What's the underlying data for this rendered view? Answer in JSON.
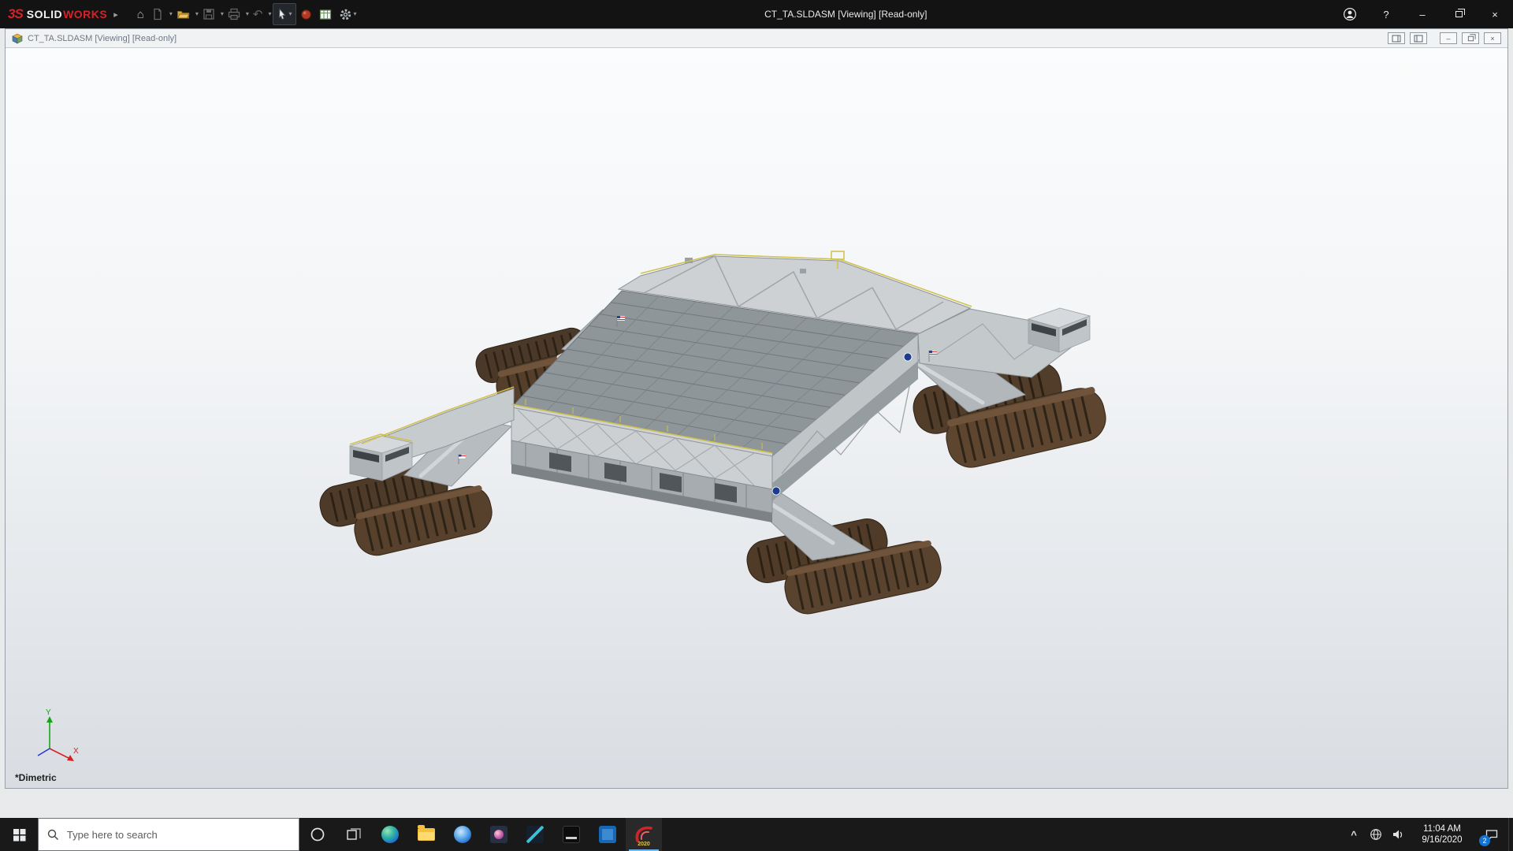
{
  "titlebar": {
    "brand_mark": "3S",
    "brand_solid": "SOLID",
    "brand_works": "WORKS",
    "flyout": "▸",
    "title": "CT_TA.SLDASM [Viewing] [Read-only]",
    "help_glyph": "?",
    "minimize_glyph": "–",
    "close_glyph": "×"
  },
  "toolbar": {
    "home_glyph": "⌂",
    "undo_glyph": "↶",
    "caret": "▾"
  },
  "doc_window": {
    "title": "CT_TA.SLDASM [Viewing] [Read-only]",
    "minimize_glyph": "–",
    "close_glyph": "×",
    "view_orientation": "*Dimetric",
    "triad": {
      "x": "X",
      "y": "Y"
    }
  },
  "taskbar": {
    "search_placeholder": "Type here to search",
    "tray_chevron": "^",
    "time": "11:04 AM",
    "date": "9/16/2020",
    "notification_badge": "2",
    "solidworks_year": "2020"
  },
  "colors": {
    "solidworks_red": "#d2232a",
    "titlebar_bg": "#131313",
    "taskbar_bg": "#191919",
    "accent_blue": "#1273d4",
    "track_brown": "#57412c",
    "deck_gray": "#8f969a",
    "viewport_top": "#fbfcfd",
    "viewport_bottom": "#d9dde2"
  }
}
